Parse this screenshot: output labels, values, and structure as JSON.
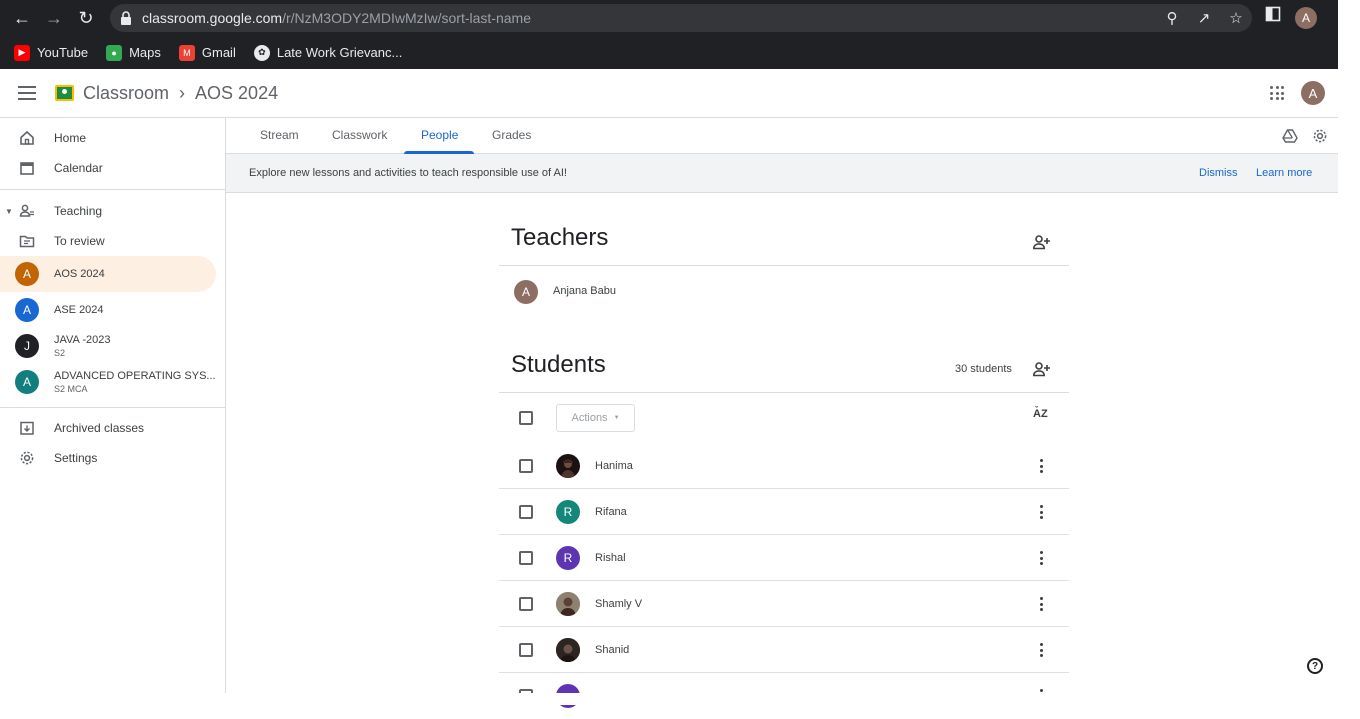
{
  "browser": {
    "url_domain": "classroom.google.com",
    "url_path": "/r/NzM3ODY2MDIwMzIw/sort-last-name",
    "profile_initial": "A",
    "bookmarks": [
      {
        "label": "YouTube",
        "icon": "youtube-icon",
        "color": "#ff0000"
      },
      {
        "label": "Maps",
        "icon": "maps-icon",
        "color": "#34a853"
      },
      {
        "label": "Gmail",
        "icon": "gmail-icon",
        "color": "#ea4335"
      },
      {
        "label": "Late Work Grievanc...",
        "icon": "openai-icon",
        "color": "#202124"
      }
    ]
  },
  "header": {
    "app_name": "Classroom",
    "separator": "›",
    "class_name": "AOS 2024",
    "avatar_initial": "A"
  },
  "sidebar": {
    "top_items": [
      {
        "label": "Home",
        "icon": "home-icon"
      },
      {
        "label": "Calendar",
        "icon": "calendar-icon"
      }
    ],
    "teaching_label": "Teaching",
    "to_review_label": "To review",
    "classes": [
      {
        "initial": "A",
        "name": "AOS 2024",
        "section": "",
        "color": "#c26401",
        "active": true
      },
      {
        "initial": "A",
        "name": "ASE 2024",
        "section": "",
        "color": "#1967d2",
        "active": false
      },
      {
        "initial": "J",
        "name": "JAVA -2023",
        "section": "S2",
        "color": "#202124",
        "active": false
      },
      {
        "initial": "A",
        "name": "ADVANCED OPERATING SYS...",
        "section": "S2 MCA",
        "color": "#137e7e",
        "active": false
      }
    ],
    "archived_label": "Archived classes",
    "settings_label": "Settings"
  },
  "tabs": {
    "items": [
      "Stream",
      "Classwork",
      "People",
      "Grades"
    ],
    "active": "People"
  },
  "banner": {
    "text": "Explore new lessons and activities to teach responsible use of AI!",
    "dismiss": "Dismiss",
    "learn_more": "Learn more"
  },
  "teachers": {
    "title": "Teachers",
    "list": [
      {
        "initial": "A",
        "name": "Anjana Babu",
        "color": "#8d6e63"
      }
    ]
  },
  "students": {
    "title": "Students",
    "count_label": "30 students",
    "actions_label": "Actions",
    "sort_label": "AZ",
    "list": [
      {
        "initial": "",
        "name": "Hanima",
        "color": "#3e2723",
        "photo": true
      },
      {
        "initial": "R",
        "name": "Rifana",
        "color": "#12877a",
        "photo": false
      },
      {
        "initial": "R",
        "name": "Rishal",
        "color": "#5e35b1",
        "photo": false
      },
      {
        "initial": "",
        "name": "Shamly V",
        "color": "#8d8172",
        "photo": true
      },
      {
        "initial": "",
        "name": "Shanid",
        "color": "#3b2f2a",
        "photo": true
      },
      {
        "initial": "",
        "name": "",
        "color": "#5e35b1",
        "photo": false
      }
    ]
  },
  "help_icon": "help-icon"
}
